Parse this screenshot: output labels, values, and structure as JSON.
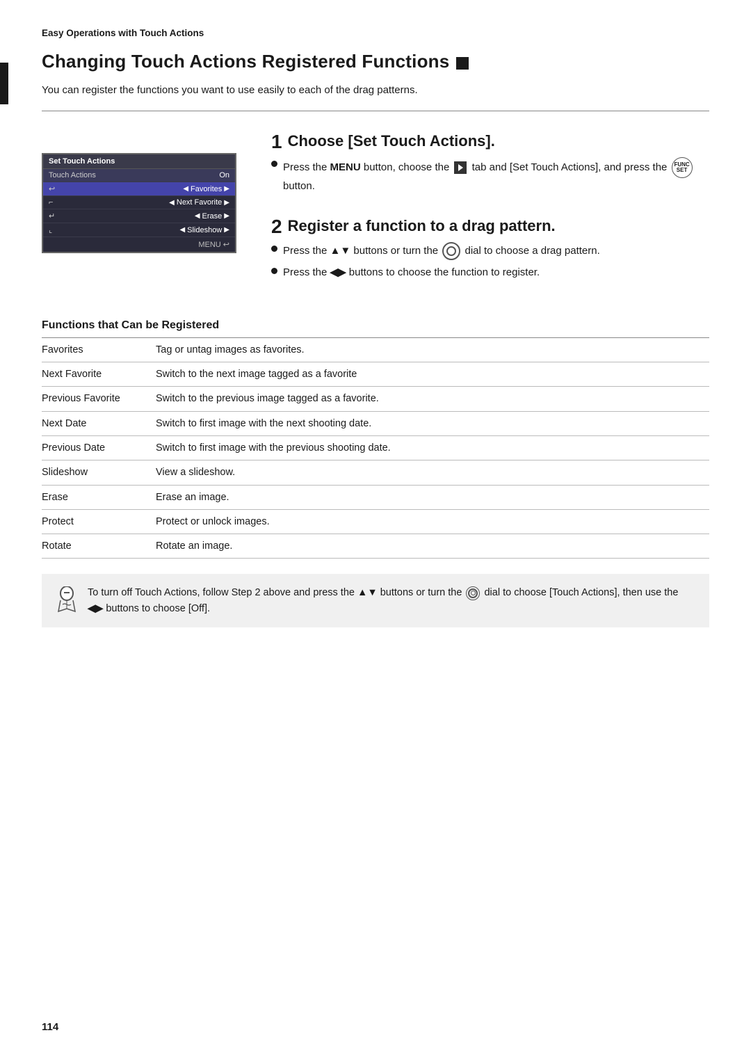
{
  "breadcrumb": "Easy Operations with Touch Actions",
  "page_title": "Changing Touch Actions Registered Functions",
  "intro": "You can register the functions you want to use easily to each of the drag patterns.",
  "step1": {
    "number": "1",
    "title": "Choose [Set Touch Actions].",
    "bullets": [
      {
        "text_parts": [
          {
            "type": "text",
            "content": "Press the "
          },
          {
            "type": "bold",
            "content": "MENU"
          },
          {
            "type": "text",
            "content": " button, choose the "
          },
          {
            "type": "icon",
            "content": "right-arrow-box"
          },
          {
            "type": "text",
            "content": " tab and [Set Touch Actions], and press the "
          },
          {
            "type": "func-btn",
            "content": "FUNC/SET"
          },
          {
            "type": "text",
            "content": " button."
          }
        ]
      }
    ]
  },
  "step2": {
    "number": "2",
    "title": "Register a function to a drag pattern.",
    "bullets": [
      {
        "text_parts": [
          {
            "type": "text",
            "content": "Press the "
          },
          {
            "type": "arrows-ud",
            "content": "▲▼"
          },
          {
            "type": "text",
            "content": " buttons or turn the "
          },
          {
            "type": "dial",
            "content": "dial"
          },
          {
            "type": "text",
            "content": " dial to choose a drag pattern."
          }
        ]
      },
      {
        "text_parts": [
          {
            "type": "text",
            "content": "Press the "
          },
          {
            "type": "arrows-lr",
            "content": "◀▶"
          },
          {
            "type": "text",
            "content": " buttons to choose the function to register."
          }
        ]
      }
    ]
  },
  "screen": {
    "title": "Set Touch Actions",
    "header_left": "Touch Actions",
    "header_right": "On",
    "rows": [
      {
        "icon": "↩",
        "value": "Favorites",
        "selected": true
      },
      {
        "icon": "⌐",
        "value": "Next Favorite",
        "selected": false
      },
      {
        "icon": "↵",
        "value": "Erase",
        "selected": false
      },
      {
        "icon": "⌞",
        "value": "Slideshow",
        "selected": false
      }
    ],
    "menu_label": "MENU ↩"
  },
  "functions_section": {
    "title": "Functions that Can be Registered",
    "rows": [
      {
        "name": "Favorites",
        "description": "Tag or untag images as favorites."
      },
      {
        "name": "Next Favorite",
        "description": "Switch to the next image tagged as a favorite"
      },
      {
        "name": "Previous Favorite",
        "description": "Switch to the previous image tagged as a favorite."
      },
      {
        "name": "Next Date",
        "description": "Switch to first image with the next shooting date."
      },
      {
        "name": "Previous Date",
        "description": "Switch to first image with the previous shooting date."
      },
      {
        "name": "Slideshow",
        "description": "View a slideshow."
      },
      {
        "name": "Erase",
        "description": "Erase an image."
      },
      {
        "name": "Protect",
        "description": "Protect or unlock images."
      },
      {
        "name": "Rotate",
        "description": "Rotate an image."
      }
    ]
  },
  "note": {
    "text": "To turn off Touch Actions, follow Step 2 above and press the ▲▼ buttons or turn the dial to choose [Touch Actions], then use the ◀▶ buttons to choose [Off]."
  },
  "page_number": "114"
}
